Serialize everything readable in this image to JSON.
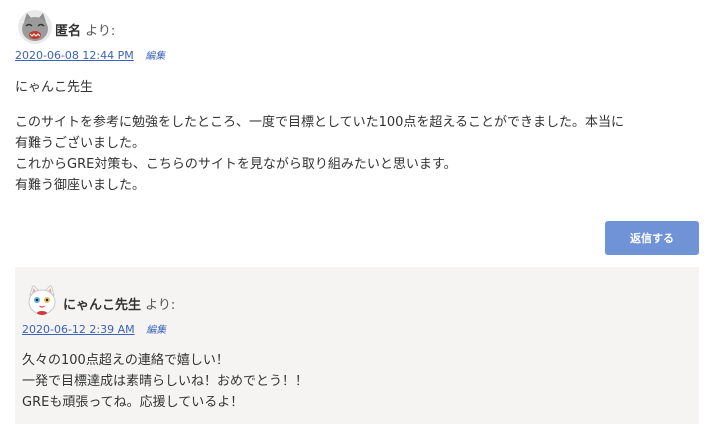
{
  "comment": {
    "author": "匿名",
    "says": "より:",
    "date": "2020-06-08 12:44 PM",
    "edit_label": "編集",
    "greeting": "にゃんこ先生",
    "paragraph_lines": [
      "このサイトを参考に勉強をしたところ、一度で目標としていた100点を超えることができました。本当に",
      "有難うございました。",
      "これからGRE対策も、こちらのサイトを見ながら取り組みたいと思います。",
      "有難う御座いました。"
    ],
    "reply_label": "返信する",
    "avatar_icon": "grey-cat-avatar-icon"
  },
  "reply": {
    "author": "にゃんこ先生",
    "says": "より:",
    "date": "2020-06-12 2:39 AM",
    "edit_label": "編集",
    "lines": [
      "久々の100点超えの連絡で嬉しい！",
      "一発で目標達成は素晴らしいね！おめでとう！！",
      "GREも頑張ってね。応援しているよ！"
    ],
    "avatar_icon": "white-cat-avatar-icon",
    "background": "#f5f4f3"
  },
  "colors": {
    "link": "#3b63b8",
    "button": "#6f93d6"
  }
}
